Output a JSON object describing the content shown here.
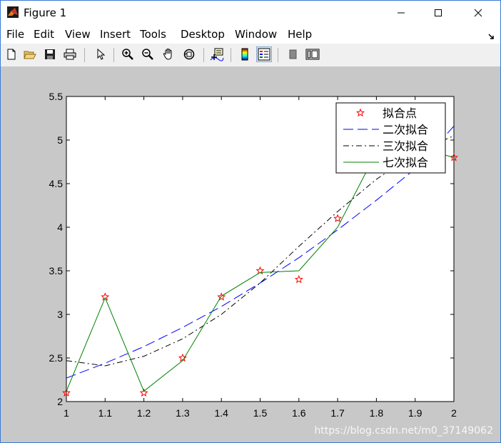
{
  "window": {
    "title": "Figure 1",
    "controls": [
      "minimize",
      "maximize",
      "close"
    ]
  },
  "menu": [
    {
      "label": "File"
    },
    {
      "label": "Edit"
    },
    {
      "label": "View"
    },
    {
      "label": "Insert"
    },
    {
      "label": "Tools"
    },
    {
      "label": "Desktop"
    },
    {
      "label": "Window"
    },
    {
      "label": "Help"
    }
  ],
  "toolbar": {
    "icons": [
      "new-figure-icon",
      "open-file-icon",
      "save-icon",
      "print-icon",
      "edit-plot-icon",
      "zoom-in-icon",
      "zoom-out-icon",
      "pan-icon",
      "rotate-3d-icon",
      "data-cursor-icon",
      "colorbar-icon",
      "legend-icon",
      "hide-plot-tools-icon",
      "show-plot-tools-icon"
    ]
  },
  "watermark": "https://blog.csdn.net/m0_37149062",
  "chart_data": {
    "type": "line",
    "xlim": [
      1,
      2
    ],
    "ylim": [
      2,
      5.5
    ],
    "xticks": [
      "1",
      "1.1",
      "1.2",
      "1.3",
      "1.4",
      "1.5",
      "1.6",
      "1.7",
      "1.8",
      "1.9",
      "2"
    ],
    "yticks": [
      "2",
      "2.5",
      "3",
      "3.5",
      "4",
      "4.5",
      "5",
      "5.5"
    ],
    "legend_position": "top-right",
    "grid": false,
    "series": [
      {
        "name": "拟合点",
        "style": "pentagram-markers",
        "color": "#ff0000",
        "x": [
          1,
          1.1,
          1.2,
          1.3,
          1.4,
          1.5,
          1.6,
          1.7,
          1.8,
          1.9,
          2
        ],
        "y": [
          2.1,
          3.2,
          2.1,
          2.5,
          3.2,
          3.5,
          3.4,
          4.1,
          4.8,
          4.9,
          4.8
        ]
      },
      {
        "name": "二次拟合",
        "style": "dashed",
        "color": "#0000ff",
        "x": [
          1,
          1.1,
          1.2,
          1.3,
          1.4,
          1.5,
          1.6,
          1.7,
          1.8,
          1.9,
          2
        ],
        "y": [
          2.27,
          2.44,
          2.63,
          2.85,
          3.09,
          3.36,
          3.65,
          3.97,
          4.31,
          4.67,
          5.16
        ]
      },
      {
        "name": "三次拟合",
        "style": "dash-dot",
        "color": "#000000",
        "x": [
          1,
          1.1,
          1.2,
          1.3,
          1.4,
          1.5,
          1.6,
          1.7,
          1.8,
          1.9,
          2
        ],
        "y": [
          2.47,
          2.41,
          2.52,
          2.72,
          3.0,
          3.36,
          3.78,
          4.18,
          4.55,
          4.85,
          5.05
        ]
      },
      {
        "name": "七次拟合",
        "style": "solid",
        "color": "#008000",
        "x": [
          1,
          1.1,
          1.2,
          1.3,
          1.4,
          1.5,
          1.6,
          1.7,
          1.8,
          1.9,
          2
        ],
        "y": [
          2.12,
          3.19,
          2.12,
          2.47,
          3.21,
          3.48,
          3.5,
          4.0,
          4.86,
          4.92,
          4.8
        ]
      }
    ]
  }
}
